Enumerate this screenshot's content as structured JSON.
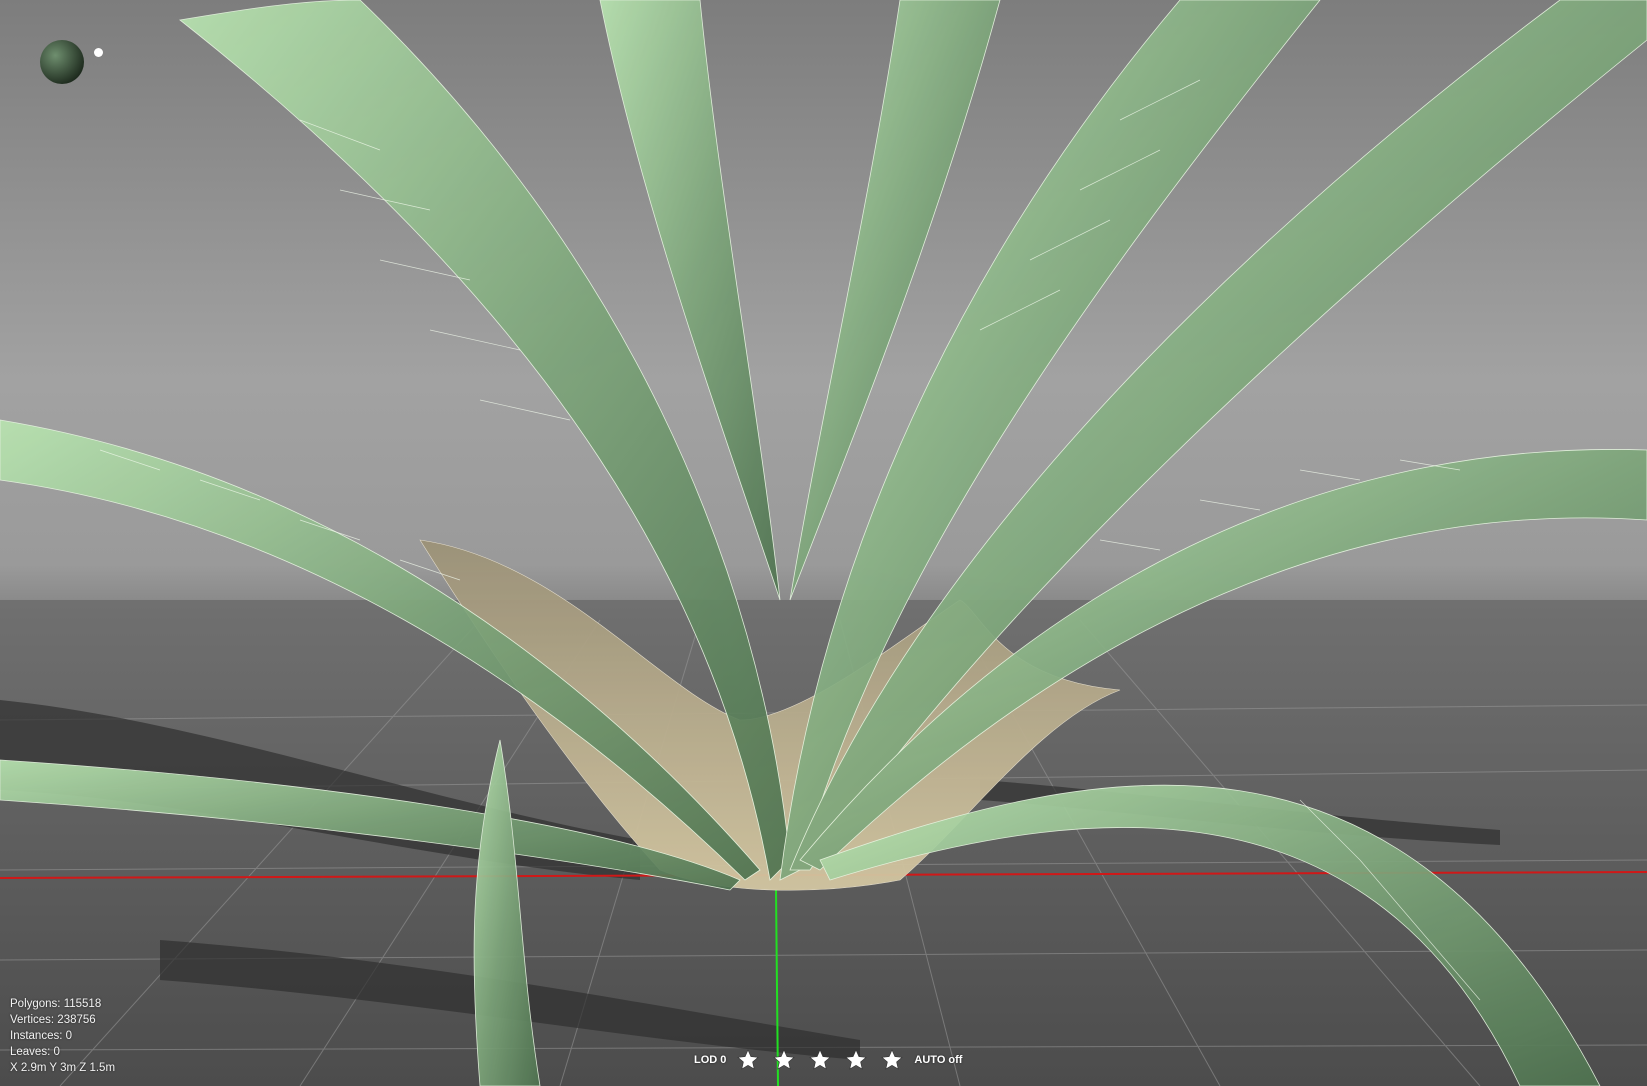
{
  "viewport": {
    "name": "3D model viewer",
    "colors": {
      "axis_x": "#d01818",
      "axis_y": "#22e022",
      "grid": "#9a9a9a",
      "leaf_light": "#a8d9a0",
      "leaf_dark": "#5b7f5a",
      "trunk": "#b9ab88"
    }
  },
  "stats": {
    "polygons": "Polygons: 115518",
    "vertices": "Vertices: 238756",
    "instances": "Instances: 0",
    "leaves": "Leaves: 0",
    "dimensions": "X 2.9m Y 3m Z 1.5m"
  },
  "lod": {
    "label": "LOD 0",
    "stars": [
      {
        "icon": "star-icon"
      },
      {
        "icon": "star-icon"
      },
      {
        "icon": "star-icon"
      },
      {
        "icon": "star-icon"
      },
      {
        "icon": "star-icon"
      }
    ],
    "auto_label": "AUTO off"
  }
}
